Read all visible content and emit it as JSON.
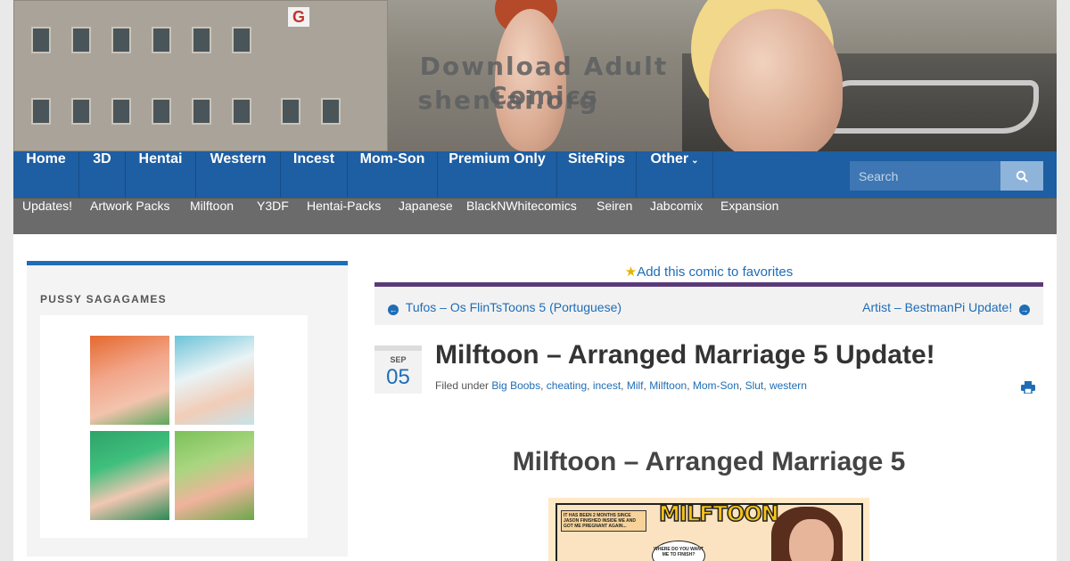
{
  "banner": {
    "title": "Download Adult Comics",
    "subtitle": "shentai.org",
    "sign_letter": "G"
  },
  "main_nav": {
    "items": [
      {
        "label": "Home"
      },
      {
        "label": "3D"
      },
      {
        "label": "Hentai"
      },
      {
        "label": "Western"
      },
      {
        "label": "Incest"
      },
      {
        "label": "Mom-Son"
      },
      {
        "label": "Premium Only"
      },
      {
        "label": "SiteRips"
      },
      {
        "label": "Other"
      }
    ],
    "search_placeholder": "Search"
  },
  "sub_nav": {
    "items": [
      {
        "label": "Updates!"
      },
      {
        "label": "Artwork Packs"
      },
      {
        "label": "Milftoon"
      },
      {
        "label": "Y3DF"
      },
      {
        "label": "Hentai-Packs"
      },
      {
        "label": "Japanese"
      },
      {
        "label": "BlackNWhitecomics"
      },
      {
        "label": "Seiren"
      },
      {
        "label": "Jabcomix"
      },
      {
        "label": "Expansion"
      }
    ]
  },
  "sidebar": {
    "widget_title": "PUSSY SAGAGAMES"
  },
  "post": {
    "favorites_label": "Add this comic to favorites",
    "prev_link": "Tufos – Os FlinTsToons 5 (Portuguese)",
    "next_link": "Artist – BestmanPi Update!",
    "date_month": "SEP",
    "date_day": "05",
    "title": "Milftoon – Arranged Marriage 5 Update!",
    "filed_under_label": "Filed under",
    "categories": [
      "Big Boobs",
      "cheating",
      "incest",
      "Milf",
      "Milftoon",
      "Mom-Son",
      "Slut",
      "western"
    ],
    "content_heading": "Milftoon – Arranged Marriage 5"
  },
  "comic_preview": {
    "logo_text": "MILFTOON",
    "caption": "IT HAS BEEN 2 MONTHS SINCE JASON FINISHED INSIDE ME AND GOT ME PREGNANT AGAIN...",
    "bubble": "WHERE DO YOU WANT ME TO FINISH?"
  },
  "colors": {
    "nav_blue": "#1e5ea2",
    "subnav_gray": "#6b6b6b",
    "link_blue": "#1e6db6",
    "accent_purple": "#5b3a7a"
  }
}
